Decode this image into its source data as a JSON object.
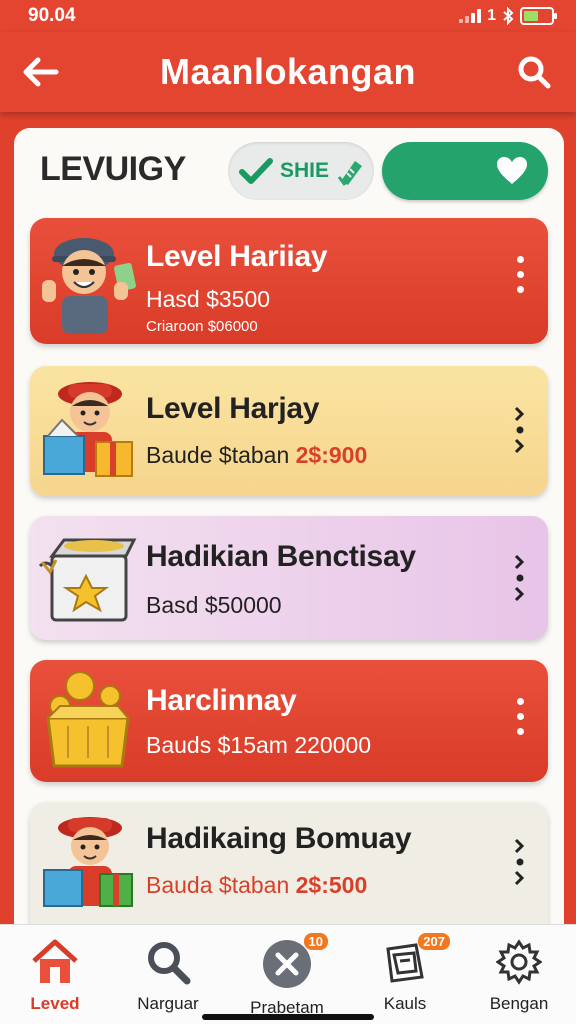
{
  "status_bar": {
    "time": "90.04",
    "signal_text": "1"
  },
  "header": {
    "title": "Maanlokangan"
  },
  "section": {
    "title": "LEVUIGY",
    "share_chip_label": "SHIE"
  },
  "cards": [
    {
      "name": "Level Hariiay",
      "detail": "Hasd $3500",
      "sub": "Criaroon $06000",
      "theme": "red"
    },
    {
      "name": "Level Harjay",
      "detail_prefix": "Baude $taban",
      "detail_highlight": "2$:900",
      "theme": "yellow"
    },
    {
      "name": "Hadikian Benctisay",
      "detail": "Basd $50000",
      "theme": "pink"
    },
    {
      "name": "Harclinnay",
      "detail": "Bauds $15am 220000",
      "theme": "red"
    },
    {
      "name": "Hadikaing Bomuay",
      "detail_prefix": "Bauda $taban",
      "detail_highlight": "2$:500",
      "theme": "cream"
    }
  ],
  "bottom_nav": [
    {
      "label": "Leved",
      "icon": "home-icon",
      "active": true
    },
    {
      "label": "Narguar",
      "icon": "search-icon"
    },
    {
      "label": "Prabetam",
      "icon": "close-circle-icon",
      "badge": "10"
    },
    {
      "label": "Kauls",
      "icon": "ledger-icon",
      "badge": "207"
    },
    {
      "label": "Bengan",
      "icon": "gear-icon"
    }
  ],
  "colors": {
    "brand_red": "#e34530",
    "accent_green": "#24a36d",
    "badge_orange": "#f07820"
  }
}
